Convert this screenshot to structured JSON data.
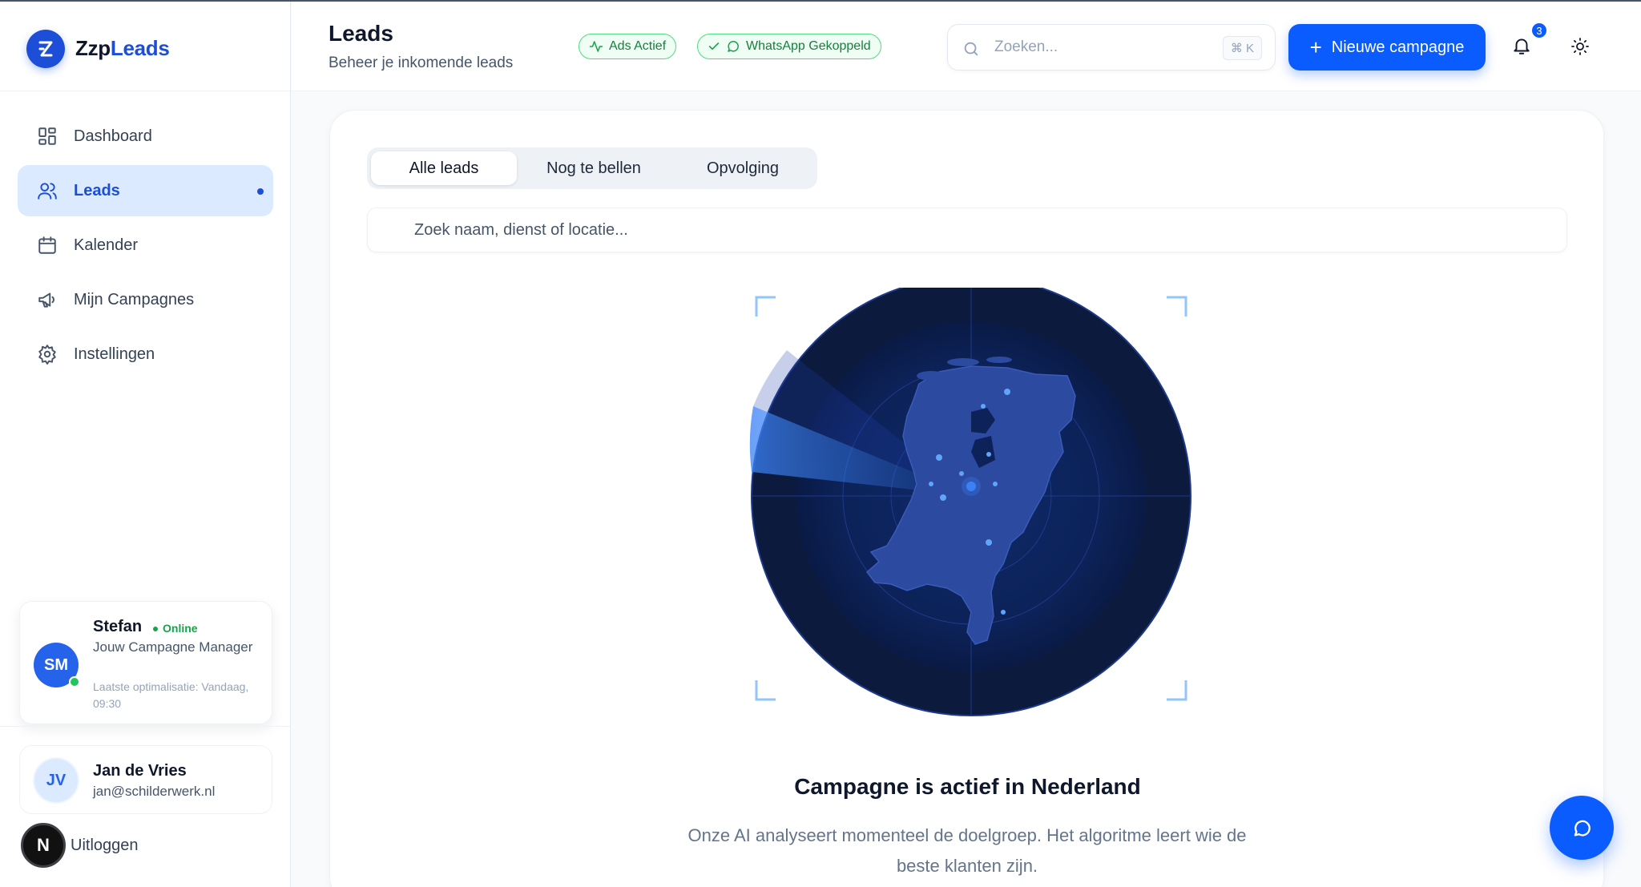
{
  "brand": {
    "name_part1": "Zzp",
    "name_part2": "Leads"
  },
  "sidebar": {
    "items": [
      {
        "label": "Dashboard",
        "icon": "dashboard-icon"
      },
      {
        "label": "Leads",
        "icon": "users-icon",
        "active": true
      },
      {
        "label": "Kalender",
        "icon": "calendar-icon"
      },
      {
        "label": "Mijn Campagnes",
        "icon": "megaphone-icon"
      },
      {
        "label": "Instellingen",
        "icon": "gear-icon"
      }
    ]
  },
  "manager": {
    "initials": "SM",
    "name": "Stefan",
    "status": "Online",
    "role": "Jouw Campagne Manager",
    "last_optimization": "Laatste optimalisatie: Vandaag, 09:30"
  },
  "user": {
    "initials": "JV",
    "name": "Jan de Vries",
    "email": "jan@schilderwerk.nl",
    "logout_badge": "N",
    "logout_label": "Uitloggen"
  },
  "header": {
    "title": "Leads",
    "subtitle": "Beheer je inkomende leads",
    "badge_ads": "Ads Actief",
    "badge_whatsapp": "WhatsApp Gekoppeld",
    "search_placeholder": "Zoeken...",
    "search_shortcut": "⌘ K",
    "cta_label": "Nieuwe campagne",
    "notification_count": "3"
  },
  "main": {
    "tabs": [
      {
        "label": "Alle leads",
        "active": true
      },
      {
        "label": "Nog te bellen"
      },
      {
        "label": "Opvolging"
      }
    ],
    "filter_placeholder": "Zoek naam, dienst of locatie...",
    "campaign_title": "Campagne is actief in Nederland",
    "campaign_desc": "Onze AI analyseert momenteel de doelgroep. Het algoritme leert wie de beste klanten zijn."
  },
  "colors": {
    "accent": "#0b5cff",
    "success": "#16a34a",
    "radar_bg": "#0b1f4d"
  }
}
